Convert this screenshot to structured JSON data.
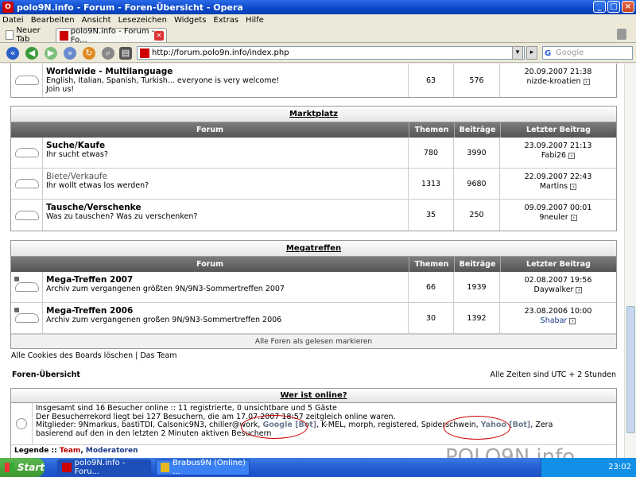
{
  "window": {
    "title": "polo9N.info - Forum - Foren-Übersicht - Opera"
  },
  "menu": [
    "Datei",
    "Bearbeiten",
    "Ansicht",
    "Lesezeichen",
    "Widgets",
    "Extras",
    "Hilfe"
  ],
  "tabs": {
    "new_tab": "Neuer Tab",
    "active_tab": "polo9N.info - Forum - Fo..."
  },
  "address": {
    "url": "http://forum.polo9n.info/index.php",
    "search_placeholder": "Google"
  },
  "top_row": {
    "name": "Worldwide - Multilanguage",
    "desc1": "English, Italian, Spanish, Turkish... everyone is very welcome!",
    "desc2": "Join us!",
    "themen": "63",
    "beitraege": "576",
    "last_date": "20.09.2007 21:38",
    "last_user": "nizde-kroatien"
  },
  "columns": {
    "forum": "Forum",
    "themen": "Themen",
    "beitraege": "Beiträge",
    "last": "Letzter Beitrag"
  },
  "marktplatz": {
    "title": "Marktplatz",
    "rows": [
      {
        "name": "Suche/Kaufe",
        "desc": "Ihr sucht etwas?",
        "themen": "780",
        "beitraege": "3990",
        "date": "23.09.2007 21:13",
        "user": "Fabi26"
      },
      {
        "name": "Biete/Verkaufe",
        "desc": "Ihr wollt etwas los werden?",
        "themen": "1313",
        "beitraege": "9680",
        "date": "22.09.2007 22:43",
        "user": "Martins"
      },
      {
        "name": "Tausche/Verschenke",
        "desc": "Was zu tauschen? Was zu verschenken?",
        "themen": "35",
        "beitraege": "250",
        "date": "09.09.2007 00:01",
        "user": "9neuler"
      }
    ]
  },
  "megatreffen": {
    "title": "Megatreffen",
    "rows": [
      {
        "name": "Mega-Treffen 2007",
        "desc": "Archiv zum vergangenen größten 9N/9N3-Sommertreffen 2007",
        "themen": "66",
        "beitraege": "1939",
        "date": "02.08.2007 19:56",
        "user": "Daywalker"
      },
      {
        "name": "Mega-Treffen 2006",
        "desc": "Archiv zum vergangenen großen 9N/9N3-Sommertreffen 2006",
        "themen": "30",
        "beitraege": "1392",
        "date": "23.08.2006 10:00",
        "user": "Shabar"
      }
    ],
    "mark_read": "Alle Foren als gelesen markieren"
  },
  "footer_links": "Alle Cookies des Boards löschen | Das Team",
  "breadcrumb": "Foren-Übersicht",
  "timezone": "Alle Zeiten sind UTC + 2 Stunden",
  "online": {
    "title": "Wer ist online?",
    "line1": "Insgesamt sind 16 Besucher online :: 11 registrierte, 0 unsichtbare und 5 Gäste",
    "line2": "Der Besucherrekord liegt bei 127 Besuchern, die am 17.07.2007 18:57 zeitgleich online waren.",
    "members_prefix": "Mitglieder: 9Nmarkus, bastiTDI, Calsonic9N3, chiller@work, ",
    "google_bot": "Google [Bot]",
    "members_mid": ", K-MEL, morph, registered, Spiderschwein, ",
    "yahoo_bot": "Yahoo [Bot]",
    "members_suffix": ", Zera",
    "line4": "basierend auf den in den letzten 2 Minuten aktiven Besuchern",
    "legend_prefix": "Legende :: ",
    "legend_team": "Team",
    "legend_mods": "Moderatoren"
  },
  "watermark": "POLO9N.info",
  "taskbar": {
    "start": "Start",
    "item1": "polo9N.info - Foru...",
    "item2": "Brabus9N (Online) ...",
    "clock": "23:02"
  }
}
